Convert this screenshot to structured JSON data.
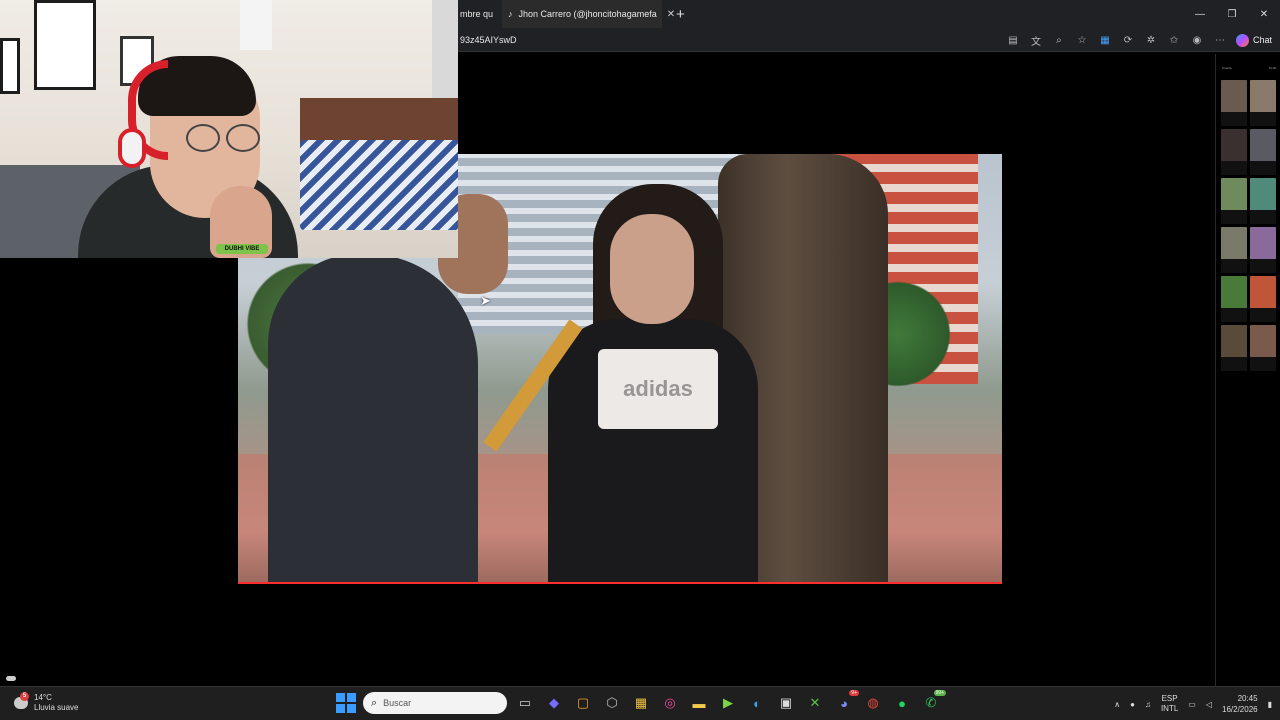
{
  "browser": {
    "tabs": [
      {
        "label": "mbre qu",
        "active": false
      },
      {
        "label": "Jhon Carrero (@jhoncitohagamefa",
        "active": true
      }
    ],
    "url": "93z45AIYswD",
    "chat_label": "Chat"
  },
  "window_controls": {
    "minimize": "—",
    "restore": "❐",
    "close": "✕"
  },
  "video": {
    "shirt_text": "adidas"
  },
  "webcam": {
    "wristband_text": "DUBHI VIBE"
  },
  "sidebar": {
    "col1": "Cuenta",
    "col2": "Perfil"
  },
  "taskbar": {
    "weather_temp": "14°C",
    "weather_desc": "Lluvia suave",
    "weather_badge": "5",
    "search_placeholder": "Buscar",
    "lang_top": "ESP",
    "lang_bottom": "INTL",
    "time": "20:45",
    "date": "16/2/2026",
    "whatsapp_badge": "99+",
    "discord_badge": "9+"
  },
  "colors": {
    "accent": "#3b9cff",
    "progress": "#ff2d2d"
  }
}
